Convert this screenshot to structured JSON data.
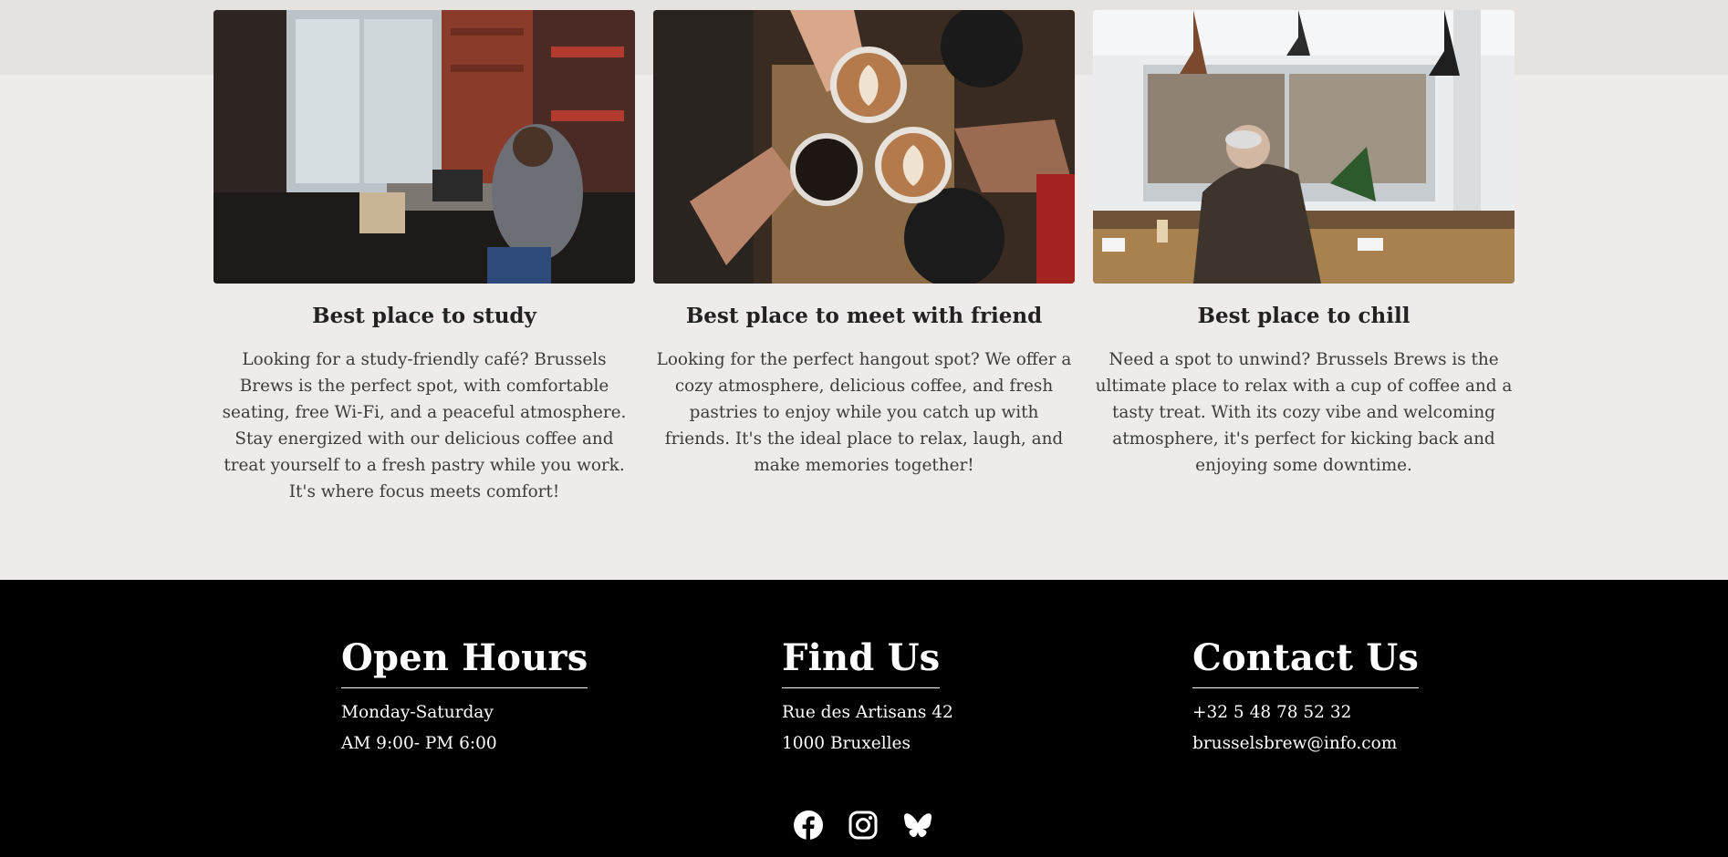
{
  "cards": [
    {
      "image_alt": "study-cafe-photo",
      "title": "Best place to study",
      "text": "Looking for a study-friendly café? Brussels Brews is the perfect spot, with comfortable seating, free Wi-Fi, and a peaceful atmosphere. Stay energized with our delicious coffee and treat yourself to a fresh pastry while you work. It's where focus meets comfort!"
    },
    {
      "image_alt": "friends-toasting-coffee-photo",
      "title": "Best place to meet with friend",
      "text": "Looking for the perfect hangout spot? We offer a cozy atmosphere, delicious coffee, and fresh pastries to enjoy while you catch up with friends. It's the ideal place to relax, laugh, and make memories together!"
    },
    {
      "image_alt": "man-relaxing-in-cafe-photo",
      "title": "Best place to chill",
      "text": "Need a spot to unwind? Brussels Brews is the ultimate place to relax with a cup of coffee and a tasty treat. With its cozy vibe and welcoming atmosphere, it's perfect for kicking back and enjoying some downtime."
    }
  ],
  "footer": {
    "hours": {
      "heading": "Open Hours",
      "line1": "Monday-Saturday",
      "line2": "AM 9:00- PM 6:00"
    },
    "find": {
      "heading": "Find Us",
      "line1": "Rue des Artisans 42",
      "line2": "1000 Bruxelles"
    },
    "contact": {
      "heading": "Contact Us",
      "line1": "+32 5 48 78 52 32",
      "line2": "brusselsbrew@info.com"
    },
    "socials": [
      "facebook-icon",
      "instagram-icon",
      "bluesky-icon"
    ]
  },
  "colors": {
    "page_bg": "#efebea",
    "footer_bg": "#000000",
    "text": "#2a2a2a"
  }
}
